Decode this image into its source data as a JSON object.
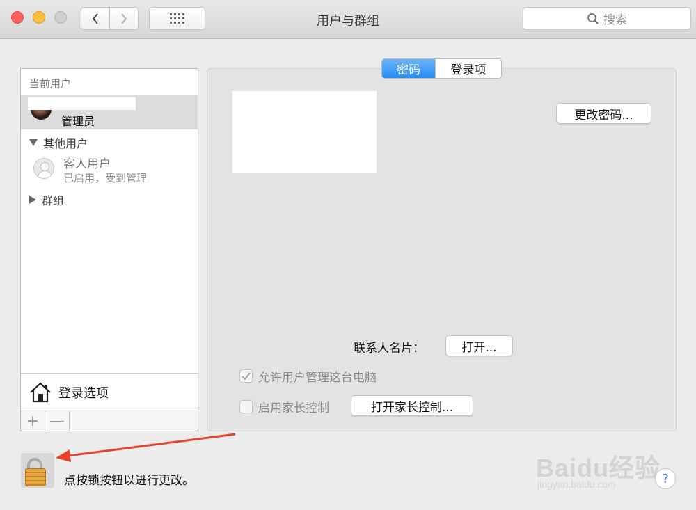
{
  "window": {
    "title": "用户与群组"
  },
  "search": {
    "placeholder": "搜索"
  },
  "sidebar": {
    "current_users_header": "当前用户",
    "admin": {
      "role": "管理员"
    },
    "other_users_header": "其他用户",
    "guest": {
      "name": "客人用户",
      "status": "已启用，受到管理"
    },
    "groups_header": "群组",
    "login_options_label": "登录选项",
    "add_label": "+",
    "remove_label": "—"
  },
  "tabs": [
    {
      "label": "密码",
      "active": true
    },
    {
      "label": "登录项",
      "active": false
    }
  ],
  "panel": {
    "change_password_label": "更改密码...",
    "contact_card_label": "联系人名片：",
    "open_button_label": "打开...",
    "allow_admin_label": "允许用户管理这台电脑",
    "allow_admin_checked": true,
    "parental_controls_label": "启用家长控制",
    "parental_controls_checked": false,
    "open_parental_label": "打开家长控制..."
  },
  "footer": {
    "lock_message": "点按锁按钮以进行更改。",
    "help_label": "?"
  },
  "watermark": {
    "brand": "Baidu经验",
    "url": "jingyan.baidu.com"
  },
  "colors": {
    "accent": "#268ef6",
    "annotation_arrow": "#e8432e"
  },
  "icons": [
    "back-icon",
    "forward-icon",
    "grid-icon",
    "search-icon",
    "house-icon",
    "lock-icon",
    "help-icon",
    "checkmark-icon"
  ]
}
